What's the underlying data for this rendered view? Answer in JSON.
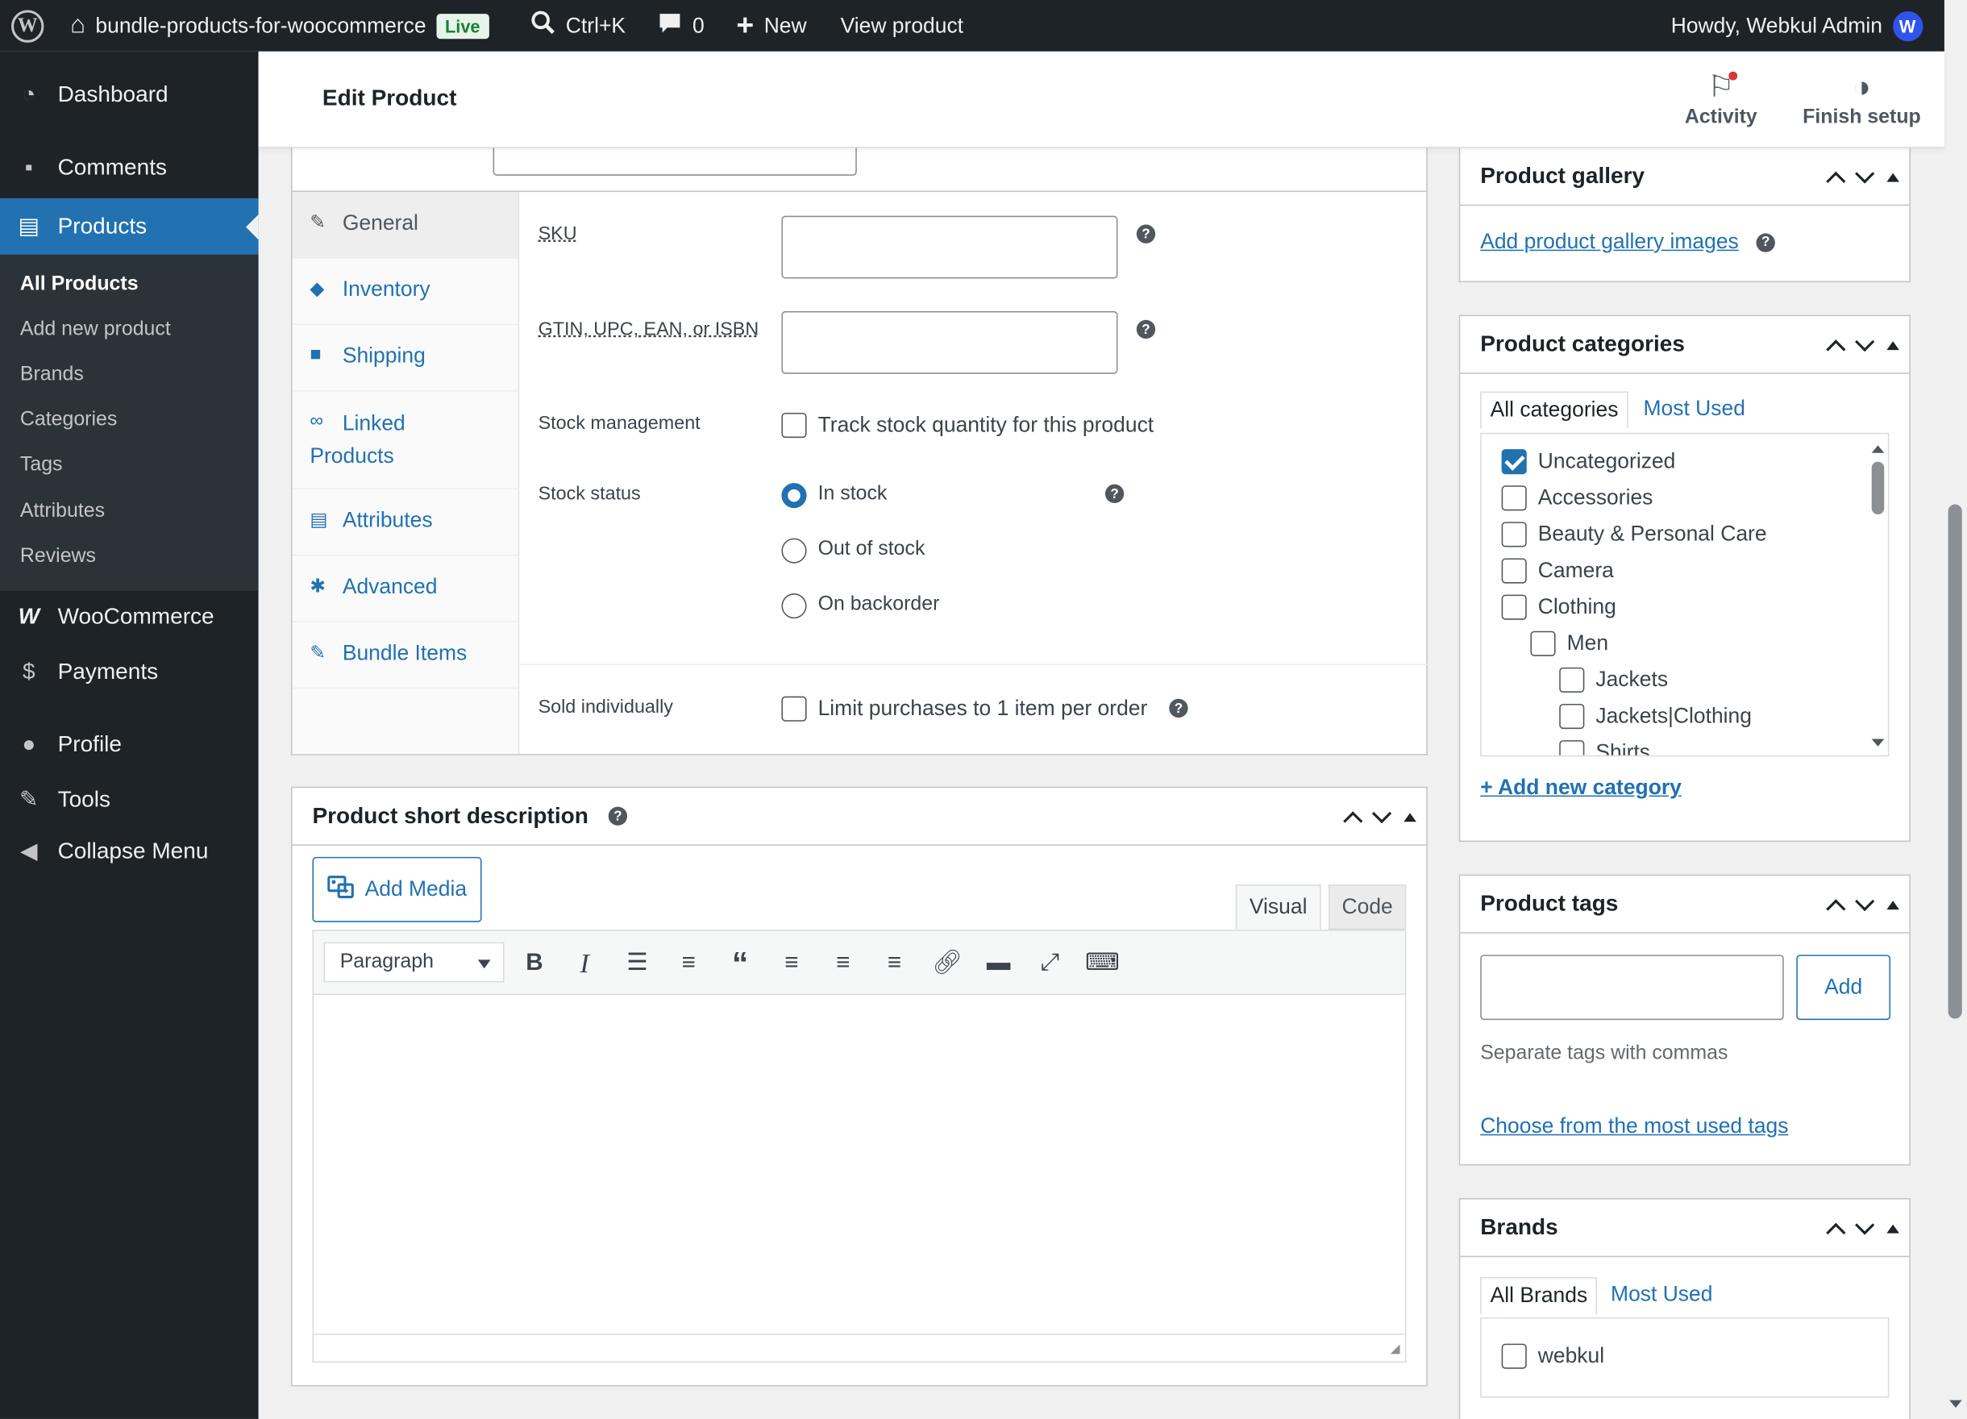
{
  "adminbar": {
    "site_name": "bundle-products-for-woocommerce",
    "live_badge": "Live",
    "search_shortcut": "Ctrl+K",
    "comments_count": "0",
    "new_label": "New",
    "view_product": "View product",
    "howdy": "Howdy, Webkul Admin"
  },
  "sidebar": {
    "dashboard": "Dashboard",
    "comments": "Comments",
    "products": "Products",
    "submenu": [
      "All Products",
      "Add new product",
      "Brands",
      "Categories",
      "Tags",
      "Attributes",
      "Reviews"
    ],
    "woocommerce": "WooCommerce",
    "payments": "Payments",
    "profile": "Profile",
    "tools": "Tools",
    "collapse": "Collapse Menu"
  },
  "header": {
    "title": "Edit Product",
    "activity": "Activity",
    "finish_setup": "Finish setup"
  },
  "product_data": {
    "tabs": [
      "General",
      "Inventory",
      "Shipping",
      "Linked Products",
      "Attributes",
      "Advanced",
      "Bundle Items"
    ],
    "sku_label": "SKU",
    "gtin_label": "GTIN, UPC, EAN, or ISBN",
    "stock_management_label": "Stock management",
    "track_stock_label": "Track stock quantity for this product",
    "stock_status_label": "Stock status",
    "stock_options": [
      "In stock",
      "Out of stock",
      "On backorder"
    ],
    "sold_individually_label": "Sold individually",
    "limit_purchases_label": "Limit purchases to 1 item per order"
  },
  "short_description": {
    "title": "Product short description",
    "add_media": "Add Media",
    "tab_visual": "Visual",
    "tab_code": "Code",
    "paragraph": "Paragraph"
  },
  "gallery": {
    "title": "Product gallery",
    "add_link": "Add product gallery images"
  },
  "categories": {
    "title": "Product categories",
    "tab_all": "All categories",
    "tab_most_used": "Most Used",
    "items": [
      {
        "label": "Uncategorized",
        "checked": true
      },
      {
        "label": "Accessories",
        "checked": false
      },
      {
        "label": "Beauty & Personal Care",
        "checked": false
      },
      {
        "label": "Camera",
        "checked": false
      },
      {
        "label": "Clothing",
        "checked": false
      },
      {
        "label": "Men",
        "checked": false
      },
      {
        "label": "Jackets",
        "checked": false
      },
      {
        "label": "Jackets|Clothing",
        "checked": false
      },
      {
        "label": "Shirts",
        "checked": false
      }
    ],
    "add_new": "+ Add new category"
  },
  "tags": {
    "title": "Product tags",
    "add_button": "Add",
    "hint": "Separate tags with commas",
    "choose_link": "Choose from the most used tags"
  },
  "brands": {
    "title": "Brands",
    "tab_all": "All Brands",
    "tab_most_used": "Most Used",
    "items": [
      {
        "label": "webkul",
        "checked": false
      }
    ]
  },
  "colors": {
    "admin_dark": "#1d2327",
    "accent": "#2271b1",
    "live_green": "#1a7f37"
  }
}
